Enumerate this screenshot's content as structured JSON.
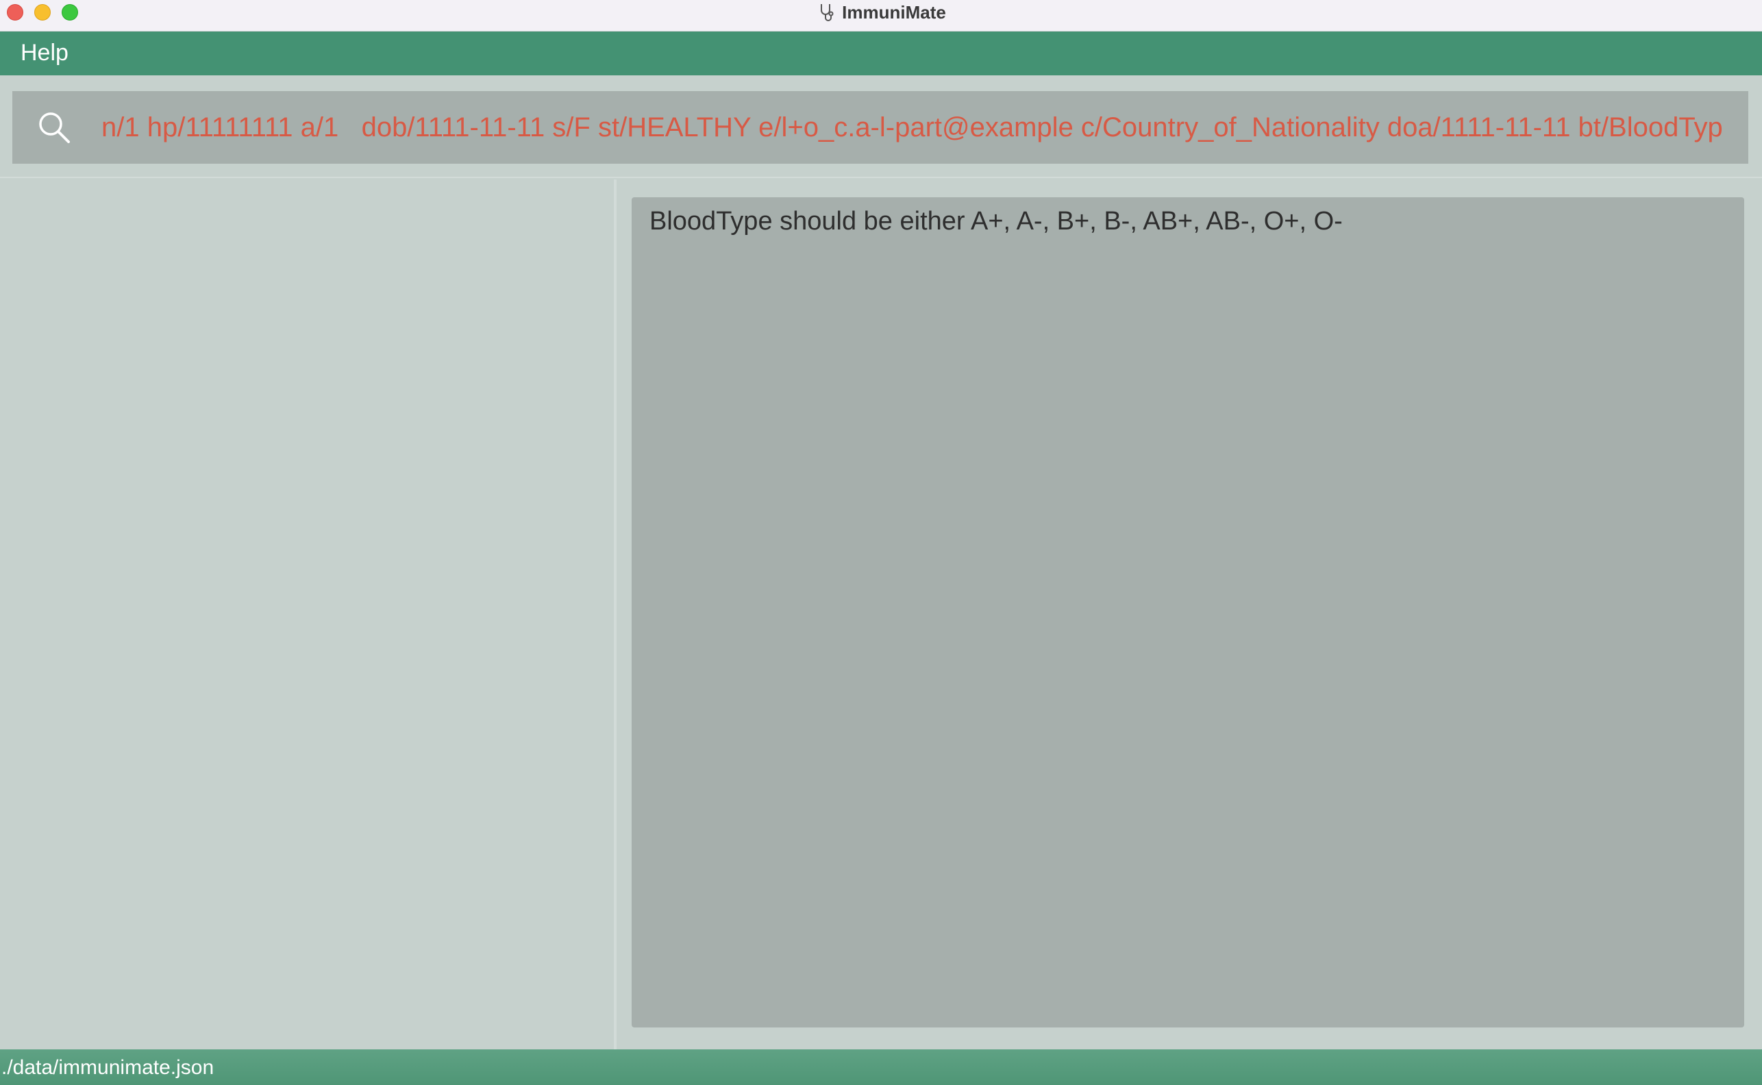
{
  "window": {
    "title": "ImmuniMate",
    "app_icon": "stethoscope-icon"
  },
  "menu": {
    "items": [
      {
        "label": "Help"
      }
    ]
  },
  "command": {
    "icon": "search-icon",
    "value": "n/1 hp/11111111 a/1   dob/1111-11-11 s/F st/HEALTHY e/l+o_c.a-l-part@example c/Country_of_Nationality doa/1111-11-11 bt/BloodTyp",
    "text_color": "#d85a45"
  },
  "result": {
    "message": "BloodType should be either A+, A-, B+, B-, AB+, AB-, O+, O-"
  },
  "status": {
    "file_path": "./data/immunimate.json"
  },
  "colors": {
    "accent": "#449273",
    "status_bar": "#5fa284",
    "panel": "#a6afac",
    "background": "#c6d1cd"
  }
}
